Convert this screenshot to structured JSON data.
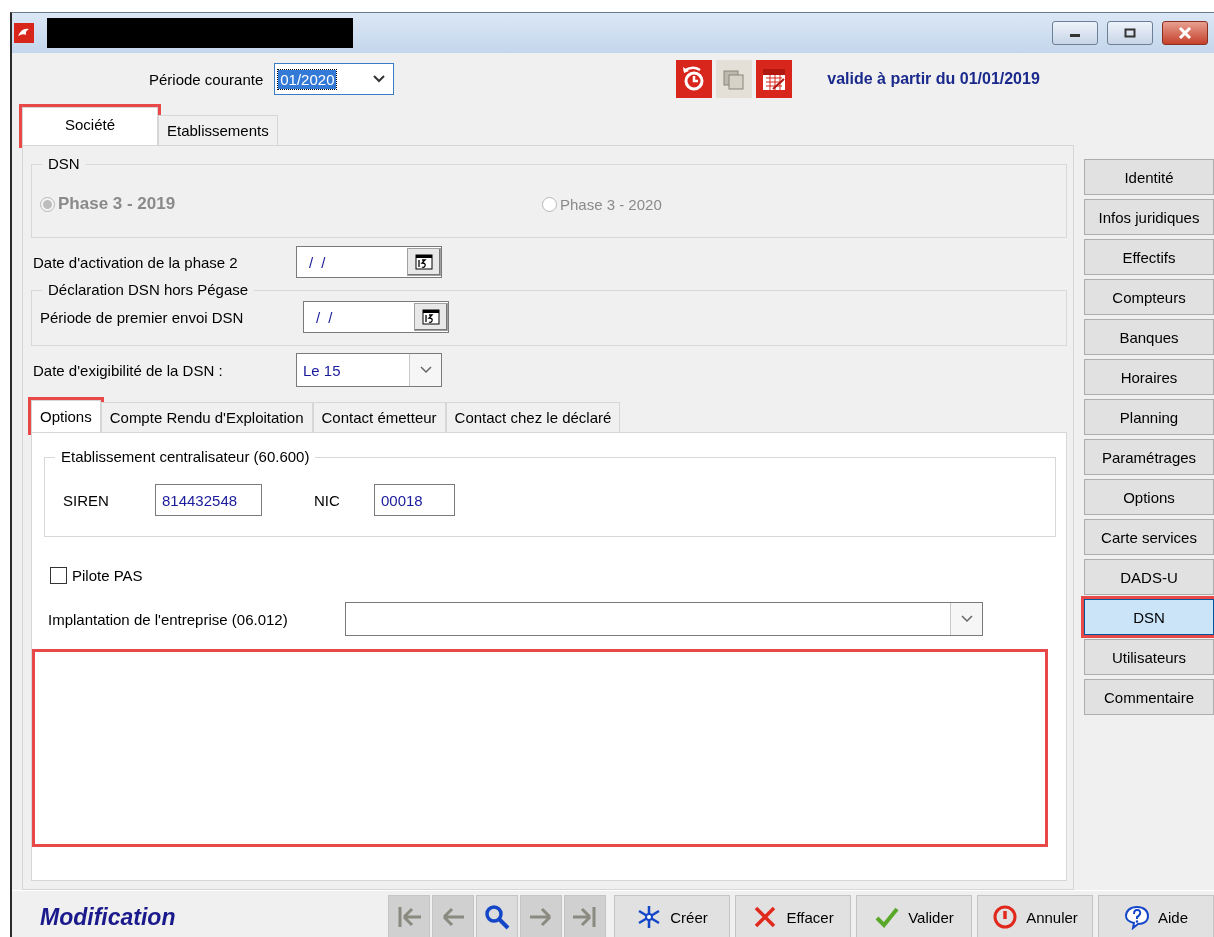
{
  "header": {
    "period_label": "Période courante",
    "period_value": "01/2020",
    "valid_text": "valide à partir du 01/01/2019"
  },
  "main_tabs": [
    {
      "label": "Société",
      "selected": true,
      "highlighted": true
    },
    {
      "label": "Etablissements",
      "selected": false,
      "highlighted": false
    }
  ],
  "dsn_group": {
    "title": "DSN",
    "disabled": true,
    "options": [
      {
        "label": "Phase 3 - 2019",
        "selected": true
      },
      {
        "label": "Phase 3 - 2020",
        "selected": false
      }
    ]
  },
  "activation": {
    "label": "Date d'activation de la phase 2",
    "value": "/ /"
  },
  "hors_pegase": {
    "title": "Déclaration DSN hors Pégase",
    "label": "Période de premier envoi DSN",
    "value": "/ /"
  },
  "exigibilite": {
    "label": "Date d'exigibilité de la DSN :",
    "value": "Le 15"
  },
  "sub_tabs": [
    {
      "label": "Options",
      "selected": true,
      "highlighted": true
    },
    {
      "label": "Compte Rendu d'Exploitation",
      "selected": false,
      "highlighted": false
    },
    {
      "label": "Contact émetteur",
      "selected": false,
      "highlighted": false
    },
    {
      "label": "Contact chez le déclaré",
      "selected": false,
      "highlighted": false
    }
  ],
  "centralisateur": {
    "title": "Etablissement centralisateur (60.600)",
    "siren_label": "SIREN",
    "siren": "814432548",
    "nic_label": "NIC",
    "nic": "00018"
  },
  "pilote": {
    "label": "Pilote PAS",
    "checked": false
  },
  "implantation": {
    "label": "Implantation de l'entreprise (06.012)"
  },
  "annotation_frame": true,
  "side_buttons": [
    {
      "label": "Identité",
      "selected": false,
      "highlighted": false
    },
    {
      "label": "Infos juridiques",
      "selected": false,
      "highlighted": false
    },
    {
      "label": "Effectifs",
      "selected": false,
      "highlighted": false
    },
    {
      "label": "Compteurs",
      "selected": false,
      "highlighted": false
    },
    {
      "label": "Banques",
      "selected": false,
      "highlighted": false
    },
    {
      "label": "Horaires",
      "selected": false,
      "highlighted": false
    },
    {
      "label": "Planning",
      "selected": false,
      "highlighted": false
    },
    {
      "label": "Paramétrages",
      "selected": false,
      "highlighted": false
    },
    {
      "label": "Options",
      "selected": false,
      "highlighted": false
    },
    {
      "label": "Carte services",
      "selected": false,
      "highlighted": false
    },
    {
      "label": "DADS-U",
      "selected": false,
      "highlighted": false
    },
    {
      "label": "DSN",
      "selected": true,
      "highlighted": true
    },
    {
      "label": "Utilisateurs",
      "selected": false,
      "highlighted": false
    },
    {
      "label": "Commentaire",
      "selected": false,
      "highlighted": false
    }
  ],
  "status": "Modification",
  "nav_buttons": [
    {
      "kind": "first",
      "disabled": true
    },
    {
      "kind": "previous",
      "disabled": true
    },
    {
      "kind": "search",
      "disabled": false
    },
    {
      "kind": "next",
      "disabled": true
    },
    {
      "kind": "last",
      "disabled": true
    }
  ],
  "action_buttons": [
    {
      "kind": "create",
      "label": "Créer"
    },
    {
      "kind": "delete",
      "label": "Effacer"
    },
    {
      "kind": "validate",
      "label": "Valider"
    },
    {
      "kind": "cancel",
      "label": "Annuler"
    },
    {
      "kind": "help",
      "label": "Aide"
    }
  ]
}
